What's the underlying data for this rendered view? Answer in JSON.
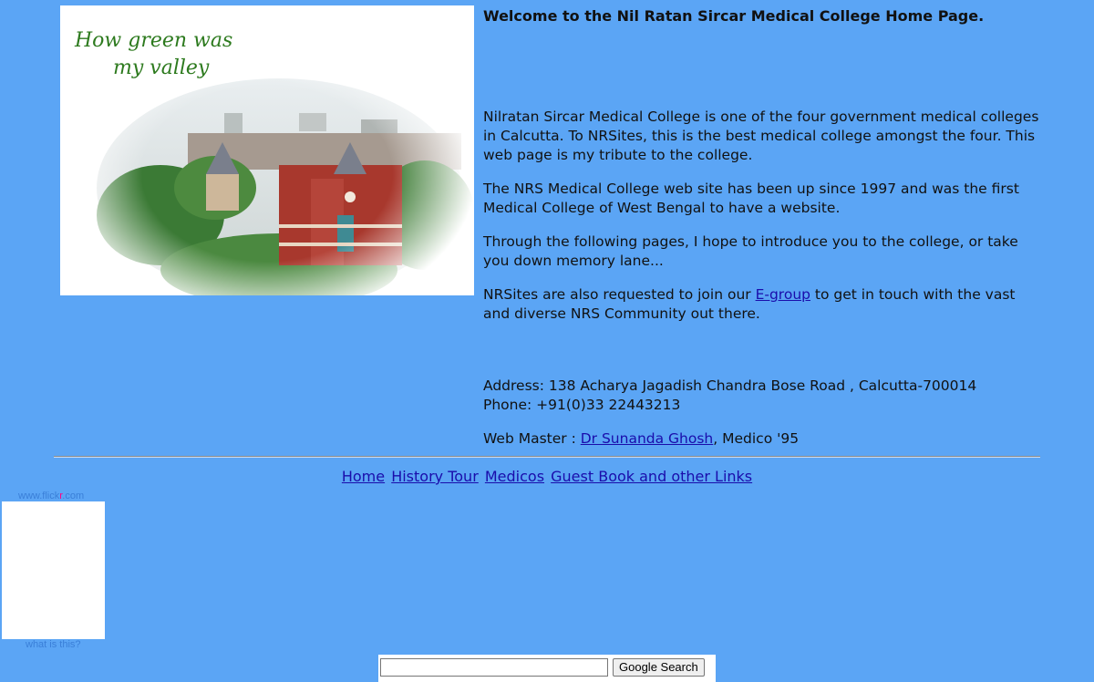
{
  "hero": {
    "logo_line1": "How green was",
    "logo_line2": "my valley"
  },
  "content": {
    "heading": "Welcome to the Nil Ratan Sircar Medical College Home Page.",
    "paragraphs": [
      "Nilratan Sircar Medical College is one of the four government medical colleges in Calcutta. To NRSites, this is the best medical college amongst the four. This web page is my tribute to the college.",
      "The NRS Medical College web site has been up since 1997 and was the first Medical College of West Bengal to have a website.",
      "Through the following pages, I hope to introduce you to the college, or take you down memory lane..."
    ],
    "egroup": {
      "before": "NRSites are also requested to join our ",
      "link": "E-group",
      "after": " to get in touch with the vast and diverse NRS Community out there."
    },
    "address": "Address: 138 Acharya Jagadish Chandra Bose Road , Calcutta-700014",
    "phone": "Phone: +91(0)33 22443213",
    "webmaster": {
      "label": "Web Master : ",
      "link": "Dr Sunanda Ghosh",
      "suffix": ", Medico '95"
    }
  },
  "nav": {
    "links": [
      "Home",
      "History Tour",
      "Medicos",
      "Guest Book and other Links"
    ]
  },
  "flickr": {
    "prefix": "www.flick",
    "r": "r",
    "suffix": ".com",
    "what_link": "what is this?"
  },
  "search": {
    "value": "",
    "button_label": "Google Search"
  },
  "colors": {
    "background": "#5ba5f5",
    "link": "#1a0dab"
  }
}
